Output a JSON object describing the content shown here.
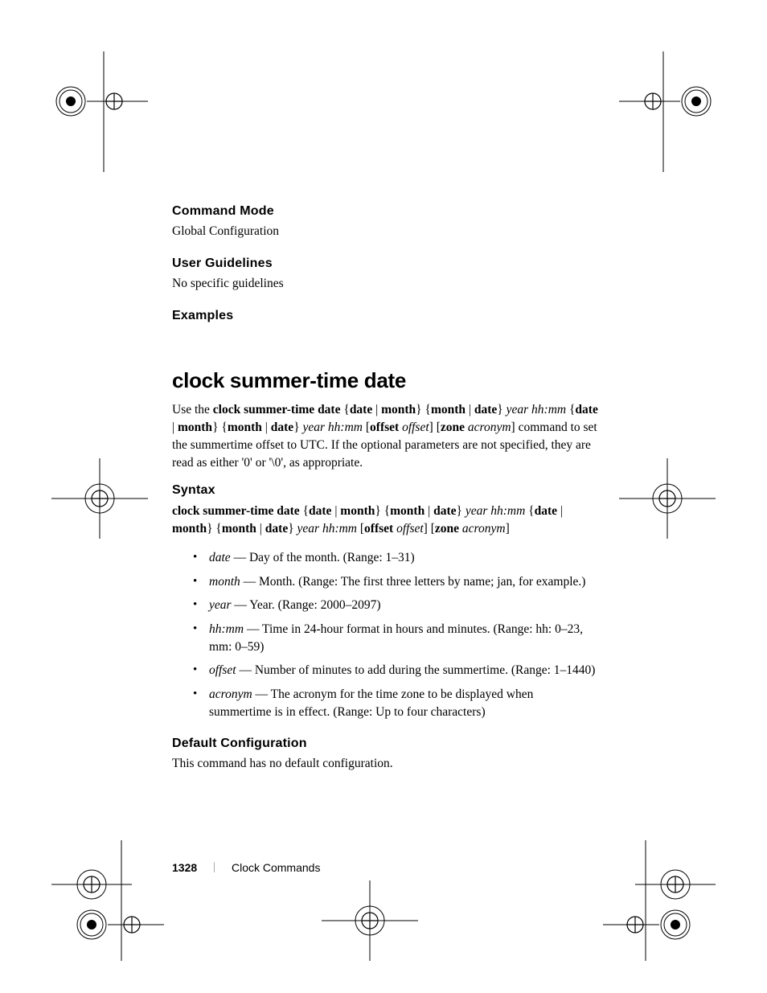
{
  "sections": {
    "command_mode": {
      "heading": "Command Mode",
      "body": "Global Configuration"
    },
    "user_guidelines": {
      "heading": "User Guidelines",
      "body": "No specific guidelines"
    },
    "examples": {
      "heading": "Examples"
    }
  },
  "command": {
    "title": "clock summer-time date",
    "intro_prefix": "Use the ",
    "intro_syntax_parts": [
      {
        "t": "kw",
        "v": "clock summer-time date"
      },
      {
        "t": "plain",
        "v": " {"
      },
      {
        "t": "kw",
        "v": "date"
      },
      {
        "t": "plain",
        "v": " | "
      },
      {
        "t": "kw",
        "v": "month"
      },
      {
        "t": "plain",
        "v": "} {"
      },
      {
        "t": "kw",
        "v": "month"
      },
      {
        "t": "plain",
        "v": " | "
      },
      {
        "t": "kw",
        "v": "date"
      },
      {
        "t": "plain",
        "v": "} "
      },
      {
        "t": "arg",
        "v": "year hh:mm"
      },
      {
        "t": "plain",
        "v": " {"
      },
      {
        "t": "kw",
        "v": "date"
      },
      {
        "t": "plain",
        "v": " | "
      },
      {
        "t": "kw",
        "v": "month"
      },
      {
        "t": "plain",
        "v": "} {"
      },
      {
        "t": "kw",
        "v": "month"
      },
      {
        "t": "plain",
        "v": " | "
      },
      {
        "t": "kw",
        "v": "date"
      },
      {
        "t": "plain",
        "v": "} "
      },
      {
        "t": "arg",
        "v": "year hh:mm"
      },
      {
        "t": "plain",
        "v": " ["
      },
      {
        "t": "kw",
        "v": "offset"
      },
      {
        "t": "plain",
        "v": " "
      },
      {
        "t": "arg",
        "v": "offset"
      },
      {
        "t": "plain",
        "v": "] ["
      },
      {
        "t": "kw",
        "v": "zone"
      },
      {
        "t": "plain",
        "v": " "
      },
      {
        "t": "arg",
        "v": "acronym"
      },
      {
        "t": "plain",
        "v": "]"
      }
    ],
    "intro_suffix": " command to set the summertime offset to UTC. If the optional parameters are not specified, they are read as either '0' or '\\0', as appropriate."
  },
  "syntax": {
    "heading": "Syntax",
    "parts": [
      {
        "t": "kw",
        "v": "clock summer-time date"
      },
      {
        "t": "plain",
        "v": " {"
      },
      {
        "t": "kw",
        "v": "date"
      },
      {
        "t": "plain",
        "v": " | "
      },
      {
        "t": "kw",
        "v": "month"
      },
      {
        "t": "plain",
        "v": "} {"
      },
      {
        "t": "kw",
        "v": "month"
      },
      {
        "t": "plain",
        "v": " | "
      },
      {
        "t": "kw",
        "v": "date"
      },
      {
        "t": "plain",
        "v": "} "
      },
      {
        "t": "arg",
        "v": "year hh:mm"
      },
      {
        "t": "plain",
        "v": " {"
      },
      {
        "t": "kw",
        "v": "date"
      },
      {
        "t": "plain",
        "v": " | "
      },
      {
        "t": "kw",
        "v": "month"
      },
      {
        "t": "plain",
        "v": "} {"
      },
      {
        "t": "kw",
        "v": "month"
      },
      {
        "t": "plain",
        "v": " | "
      },
      {
        "t": "kw",
        "v": "date"
      },
      {
        "t": "plain",
        "v": "} "
      },
      {
        "t": "arg",
        "v": "year hh:mm"
      },
      {
        "t": "plain",
        "v": " ["
      },
      {
        "t": "kw",
        "v": "offset"
      },
      {
        "t": "plain",
        "v": " "
      },
      {
        "t": "arg",
        "v": "offset"
      },
      {
        "t": "plain",
        "v": "] ["
      },
      {
        "t": "kw",
        "v": "zone"
      },
      {
        "t": "plain",
        "v": " "
      },
      {
        "t": "arg",
        "v": "acronym"
      },
      {
        "t": "plain",
        "v": "]"
      }
    ],
    "params": [
      {
        "name": "date",
        "desc": " — Day of the month. (Range: 1–31)"
      },
      {
        "name": "month",
        "desc": " — Month. (Range: The first three letters by name; jan, for example.)"
      },
      {
        "name": "year",
        "desc": " — Year. (Range: 2000–2097)"
      },
      {
        "name": "hh:mm",
        "desc": " — Time in 24-hour format in hours and minutes. (Range: hh: 0–23, mm: 0–59)"
      },
      {
        "name": "offset",
        "desc": " — Number of minutes to add during the summertime. (Range: 1–1440)"
      },
      {
        "name": "acronym",
        "desc": " — The acronym for the time zone to be displayed when summertime is in effect. (Range: Up to four characters)"
      }
    ]
  },
  "default_config": {
    "heading": "Default Configuration",
    "body": "This command has no default configuration."
  },
  "footer": {
    "page": "1328",
    "divider": "|",
    "section": "Clock Commands"
  }
}
